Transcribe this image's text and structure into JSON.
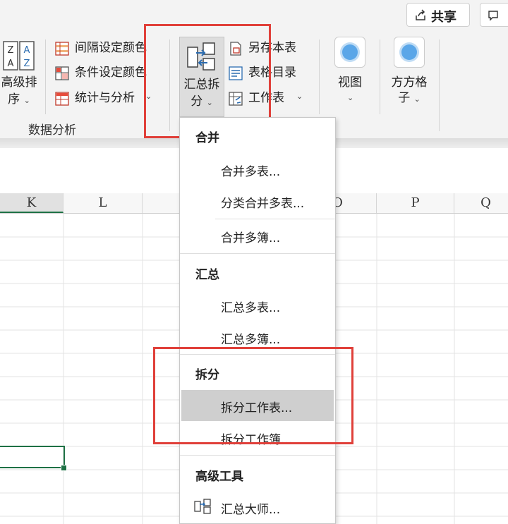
{
  "top_buttons": {
    "share": "共享",
    "comment_fragment": ""
  },
  "ribbon": {
    "sort_button": {
      "line1": "高级排",
      "line2": "序"
    },
    "data_analysis_items": [
      "间隔设定颜色",
      "条件设定颜色",
      "统计与分析"
    ],
    "group_label": "数据分析",
    "summary_split_button": {
      "line1": "汇总拆",
      "line2": "分"
    },
    "sheet_items": [
      "另存本表",
      "表格目录",
      "工作表"
    ],
    "view_button": "视图",
    "fang_button": {
      "line1": "方方格",
      "line2": "子"
    }
  },
  "columns": [
    "K",
    "L",
    "",
    "O",
    "P",
    "Q"
  ],
  "menu": {
    "sections": [
      {
        "header": "合并",
        "items": [
          "合并多表...",
          "分类合并多表...",
          "合并多簿..."
        ]
      },
      {
        "header": "汇总",
        "items": [
          "汇总多表...",
          "汇总多簿..."
        ]
      },
      {
        "header": "拆分",
        "items": [
          "拆分工作表...",
          "拆分工作簿..."
        ]
      },
      {
        "header": "高级工具",
        "items": [
          "汇总大师..."
        ]
      }
    ]
  },
  "colors": {
    "accent_red": "#e0403a",
    "excel_green": "#1e7145",
    "hover_gray": "#cfcfcf"
  }
}
